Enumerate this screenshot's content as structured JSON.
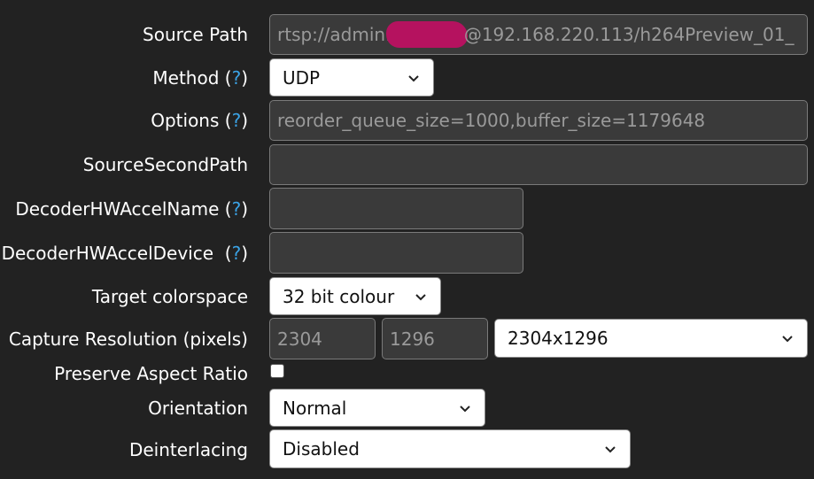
{
  "fields": {
    "source_path": {
      "label": "Source Path",
      "value_prefix": "rtsp://admin:",
      "value_suffix": "@192.168.220.113/h264Preview_01_"
    },
    "method": {
      "label": "Method (",
      "help": "?",
      "label_end": ")",
      "value": "UDP"
    },
    "options": {
      "label": "Options (",
      "help": "?",
      "label_end": ")",
      "value": "reorder_queue_size=1000,buffer_size=1179648"
    },
    "source_second_path": {
      "label": "SourceSecondPath",
      "value": ""
    },
    "decoder_hw_accel_name": {
      "label": "DecoderHWAccelName (",
      "help": "?",
      "label_end": ")",
      "value": ""
    },
    "decoder_hw_accel_device": {
      "label": "DecoderHWAccelDevice  (",
      "help": "?",
      "label_end": ")",
      "value": ""
    },
    "target_colorspace": {
      "label": "Target colorspace",
      "value": "32 bit colour"
    },
    "capture_resolution": {
      "label": "Capture Resolution (pixels)",
      "width": "2304",
      "height": "1296",
      "preset": "2304x1296"
    },
    "preserve_aspect_ratio": {
      "label": "Preserve Aspect Ratio",
      "checked": false
    },
    "orientation": {
      "label": "Orientation",
      "value": "Normal"
    },
    "deinterlacing": {
      "label": "Deinterlacing",
      "value": "Disabled"
    }
  },
  "colors": {
    "background": "#222222",
    "help_link": "#3ba3e6",
    "redaction": "#b5125f"
  }
}
